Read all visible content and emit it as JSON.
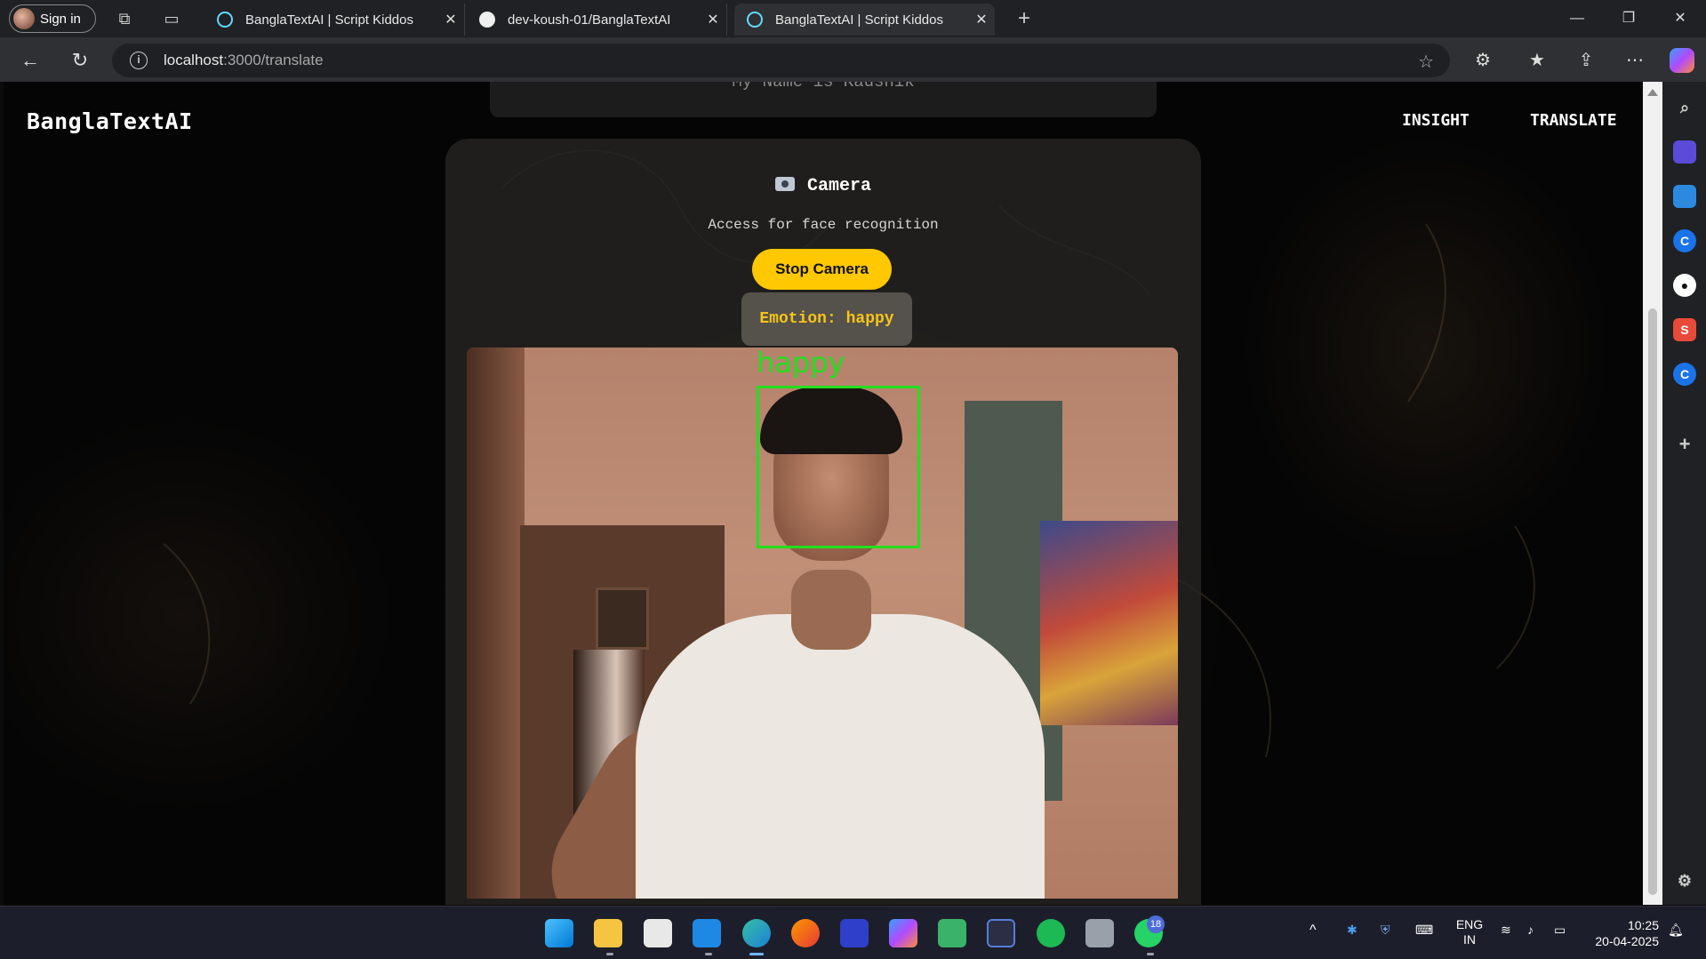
{
  "browser": {
    "signin_label": "Sign in",
    "tabs": [
      {
        "title": "BanglaTextAI | Script Kiddos",
        "icon": "react-icon"
      },
      {
        "title": "dev-koush-01/BanglaTextAI",
        "icon": "github-icon"
      },
      {
        "title": "BanglaTextAI | Script Kiddos",
        "icon": "react-icon"
      }
    ],
    "url_host": "localhost",
    "url_path": ":3000/translate"
  },
  "page": {
    "top_card_text": "My Name is Kaushik",
    "brand": "BanglaTextAI",
    "nav": {
      "insight": "INSIGHT",
      "translate": "TRANSLATE"
    },
    "camera": {
      "title": "Camera",
      "subtitle": "Access for face recognition",
      "stop_button": "Stop Camera",
      "emotion_text": "Emotion: happy",
      "face_label": "happy"
    }
  },
  "taskbar": {
    "lang_top": "ENG",
    "lang_bottom": "IN",
    "time": "10:25",
    "date": "20-04-2025",
    "whatsapp_badge": "18"
  },
  "colors": {
    "accent_yellow": "#ffc800",
    "emotion_text": "#f5c518",
    "face_box": "#22e01e"
  }
}
